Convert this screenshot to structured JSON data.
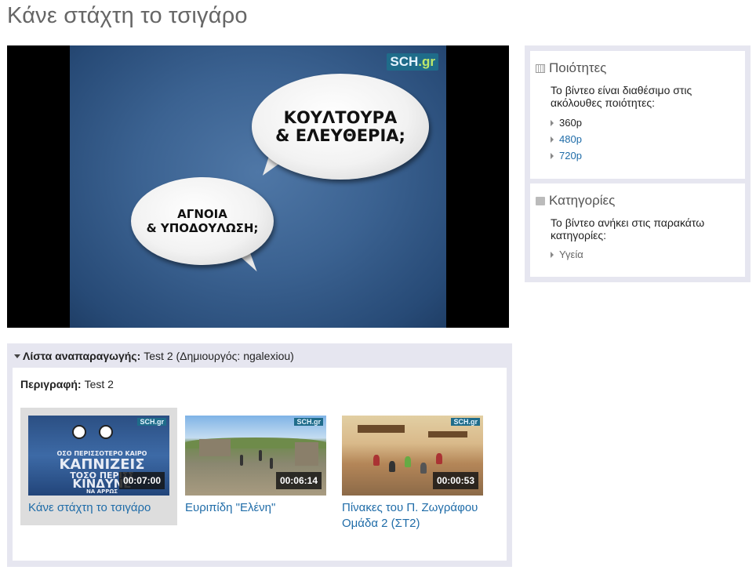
{
  "page": {
    "title": "Κάνε στάχτη το τσιγάρο"
  },
  "player": {
    "logo": {
      "main": "SCH",
      "suffix": ".gr"
    },
    "bubble_top": {
      "line1": "ΚΟΥΛΤΟΥΡΑ",
      "line2": "& ΕΛΕΥΘΕΡΙΑ;"
    },
    "bubble_bottom": {
      "line1": "ΑΓΝΟΙΑ",
      "line2": "& ΥΠΟΔΟΥΛΩΣΗ;"
    }
  },
  "qualities": {
    "title": "Ποιότητες",
    "text": "Το βίντεο είναι διαθέσιμο στις ακόλουθες ποιότητες:",
    "items": [
      {
        "label": "360p",
        "link": false
      },
      {
        "label": "480p",
        "link": true
      },
      {
        "label": "720p",
        "link": true
      }
    ]
  },
  "categories": {
    "title": "Κατηγορίες",
    "text": "Το βίντεο ανήκει στις παρακάτω κατηγορίες:",
    "items": [
      {
        "label": "Υγεία"
      }
    ]
  },
  "playlist": {
    "header_label": "Λίστα αναπαραγωγής:",
    "header_value": "Test 2 (Δημιουργός: ngalexiou)",
    "description_label": "Περιγραφή:",
    "description_value": "Test 2",
    "items": [
      {
        "title": "Κάνε στάχτη το τσιγάρο",
        "duration": "00:07:00",
        "badge": "SCH.gr",
        "active": true,
        "thumb_text": [
          "ΟΣΟ ΠΕΡΙΣΣΟΤΕΡΟ ΚΑΙΡΟ",
          "ΚΑΠΝΙΖΕΙΣ",
          "ΤΟΣΟ ΠΕΡΙΣΣ",
          "ΚΙΝΔΥΝΕ",
          "ΝΑ ΑΡΡΩΣ"
        ]
      },
      {
        "title": "Ευριπίδη \"Ελένη\"",
        "duration": "00:06:14",
        "badge": "SCH.gr",
        "active": false
      },
      {
        "title": "Πίνακες του Π. Ζωγράφου Ομάδα 2 (ΣΤ2)",
        "duration": "00:00:53",
        "badge": "SCH.gr",
        "active": false
      }
    ]
  }
}
